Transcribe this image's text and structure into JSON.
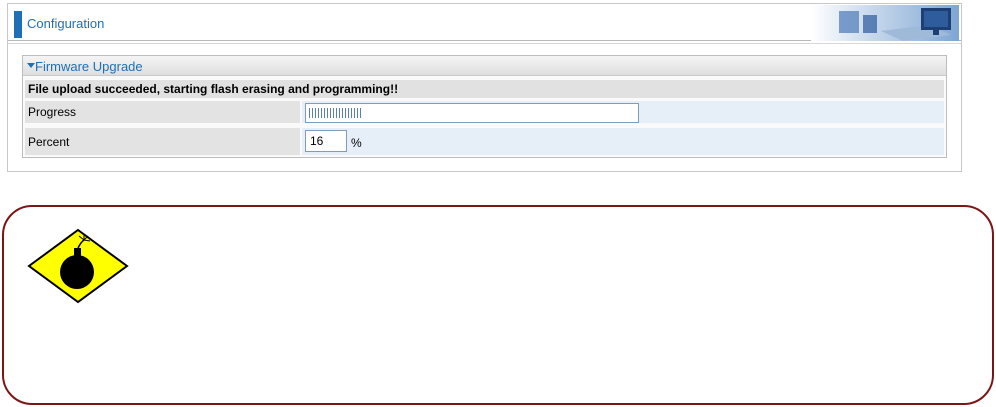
{
  "header": {
    "title": "Configuration"
  },
  "panel": {
    "title": "Firmware Upgrade"
  },
  "status": {
    "message": "File upload succeeded, starting flash erasing and programming!!"
  },
  "progress": {
    "label": "Progress",
    "fraction": 0.16
  },
  "percent": {
    "label": "Percent",
    "value": "16",
    "unit": "%"
  },
  "icons": {
    "header_art": "office-desk-icon",
    "warning": "bomb-warning-icon",
    "collapse": "triangle-down-icon"
  },
  "colors": {
    "accent": "#1f6fb6",
    "warning_border": "#7b1616",
    "warning_fill": "#ffff00"
  }
}
